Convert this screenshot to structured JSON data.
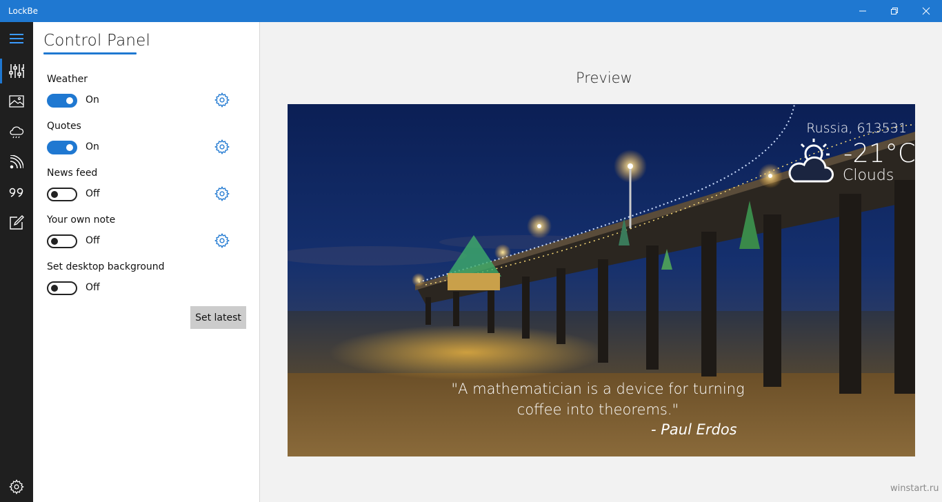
{
  "window": {
    "title": "LockBe"
  },
  "panel": {
    "title": "Control Panel"
  },
  "settings": [
    {
      "label": "Weather",
      "state": "On"
    },
    {
      "label": "Quotes",
      "state": "On"
    },
    {
      "label": "News feed",
      "state": "Off"
    },
    {
      "label": "Your own note",
      "state": "Off"
    },
    {
      "label": "Set desktop background",
      "state": "Off"
    }
  ],
  "set_latest_label": "Set latest",
  "preview": {
    "title": "Preview",
    "location": "Russia, 613531",
    "temperature": "-21°C",
    "condition": "Clouds",
    "quote": "\"A mathematician is a device for turning coffee into theorems.\"",
    "author": "- Paul Erdos"
  },
  "watermark": "winstart.ru",
  "icons": {
    "menu": "hamburger-icon",
    "control": "sliders-icon",
    "images": "image-icon",
    "weather": "weather-icon",
    "rss": "rss-icon",
    "quotes": "quote-icon",
    "note": "edit-icon",
    "settings": "gear-icon"
  },
  "colors": {
    "accent": "#1f78d1",
    "rail": "#1f1f1f"
  }
}
